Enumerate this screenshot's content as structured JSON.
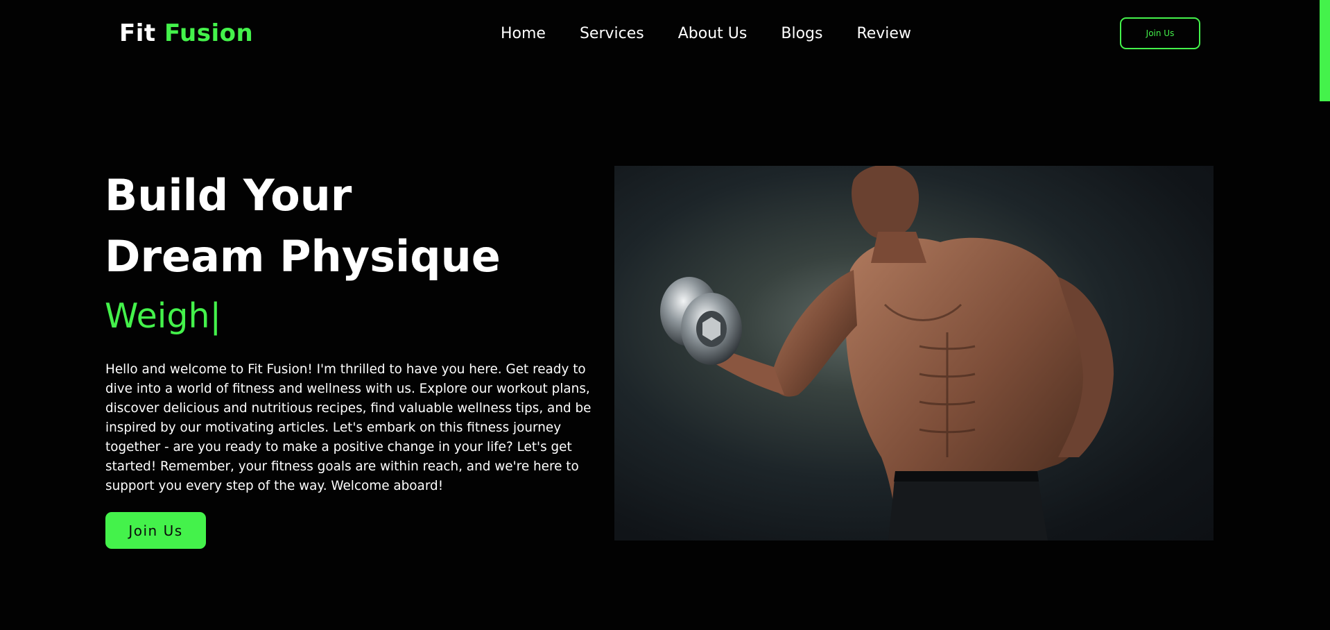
{
  "brand": {
    "name_part1": "Fit",
    "name_part2": "Fusion",
    "accent_color": "#44f24b"
  },
  "nav": {
    "links": [
      "Home",
      "Services",
      "About Us",
      "Blogs",
      "Review"
    ],
    "join_label": "Join Us"
  },
  "hero": {
    "title_line1": "Build Your",
    "title_line2": "Dream Physique",
    "typed_text": "Weigh|",
    "description": "Hello and welcome to Fit Fusion! I'm thrilled to have you here. Get ready to dive into a world of fitness and wellness with us. Explore our workout plans, discover delicious and nutritious recipes, find valuable wellness tips, and be inspired by our motivating articles. Let's embark on this fitness journey together - are you ready to make a positive change in your life? Let's get started! Remember, your fitness goals are within reach, and we're here to support you every step of the way. Welcome aboard!",
    "cta_label": "Join Us",
    "image_icon": "bodybuilder-dumbbell-photo"
  }
}
